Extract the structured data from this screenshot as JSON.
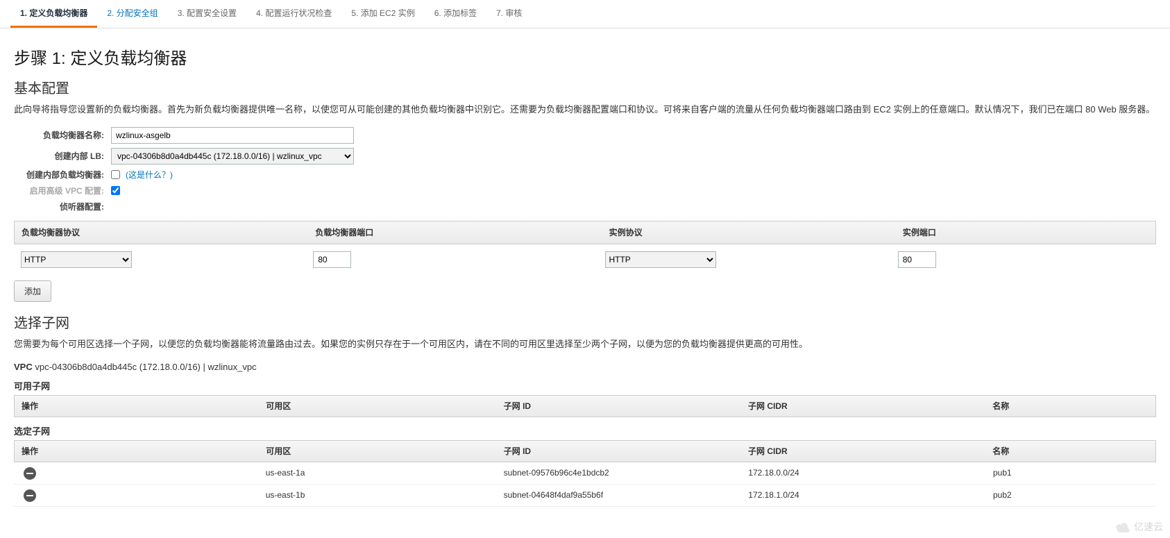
{
  "tabs": [
    "1. 定义负载均衡器",
    "2. 分配安全组",
    "3. 配置安全设置",
    "4. 配置运行状况检查",
    "5. 添加 EC2 实例",
    "6. 添加标签",
    "7. 审核"
  ],
  "step_title": "步骤 1: 定义负载均衡器",
  "basic": {
    "title": "基本配置",
    "desc": "此向导将指导您设置新的负载均衡器。首先为新负载均衡器提供唯一名称，以使您可从可能创建的其他负载均衡器中识别它。还需要为负载均衡器配置端口和协议。可将来自客户端的流量从任何负载均衡器端口路由到 EC2 实例上的任意端口。默认情况下，我们已在端口 80 Web 服务器。",
    "name_label": "负载均衡器名称:",
    "name_value": "wzlinux-asgelb",
    "createin_label": "创建内部 LB:",
    "createin_value": "vpc-04306b8d0a4db445c (172.18.0.0/16) | wzlinux_vpc",
    "internal_label": "创建内部负载均衡器:",
    "internal_hint": "(这是什么？)",
    "advanced_label": "启用高级 VPC 配置:",
    "listeners_label": "侦听器配置:"
  },
  "listener_headers": {
    "lb_proto": "负载均衡器协议",
    "lb_port": "负载均衡器端口",
    "inst_proto": "实例协议",
    "inst_port": "实例端口"
  },
  "listener": {
    "lb_proto": "HTTP",
    "lb_port": "80",
    "inst_proto": "HTTP",
    "inst_port": "80"
  },
  "add_button": "添加",
  "subnet": {
    "title": "选择子网",
    "desc": "您需要为每个可用区选择一个子网，以便您的负载均衡器能将流量路由过去。如果您的实例只存在于一个可用区内，请在不同的可用区里选择至少两个子网，以便为您的负载均衡器提供更高的可用性。",
    "vpc_label": "VPC",
    "vpc_value": "vpc-04306b8d0a4db445c (172.18.0.0/16) | wzlinux_vpc",
    "available_title": "可用子网",
    "selected_title": "选定子网",
    "headers": {
      "action": "操作",
      "az": "可用区",
      "sid": "子网 ID",
      "cidr": "子网 CIDR",
      "name": "名称"
    },
    "selected_rows": [
      {
        "az": "us-east-1a",
        "sid": "subnet-09576b96c4e1bdcb2",
        "cidr": "172.18.0.0/24",
        "name": "pub1"
      },
      {
        "az": "us-east-1b",
        "sid": "subnet-04648f4daf9a55b6f",
        "cidr": "172.18.1.0/24",
        "name": "pub2"
      }
    ]
  },
  "watermark": "亿速云"
}
